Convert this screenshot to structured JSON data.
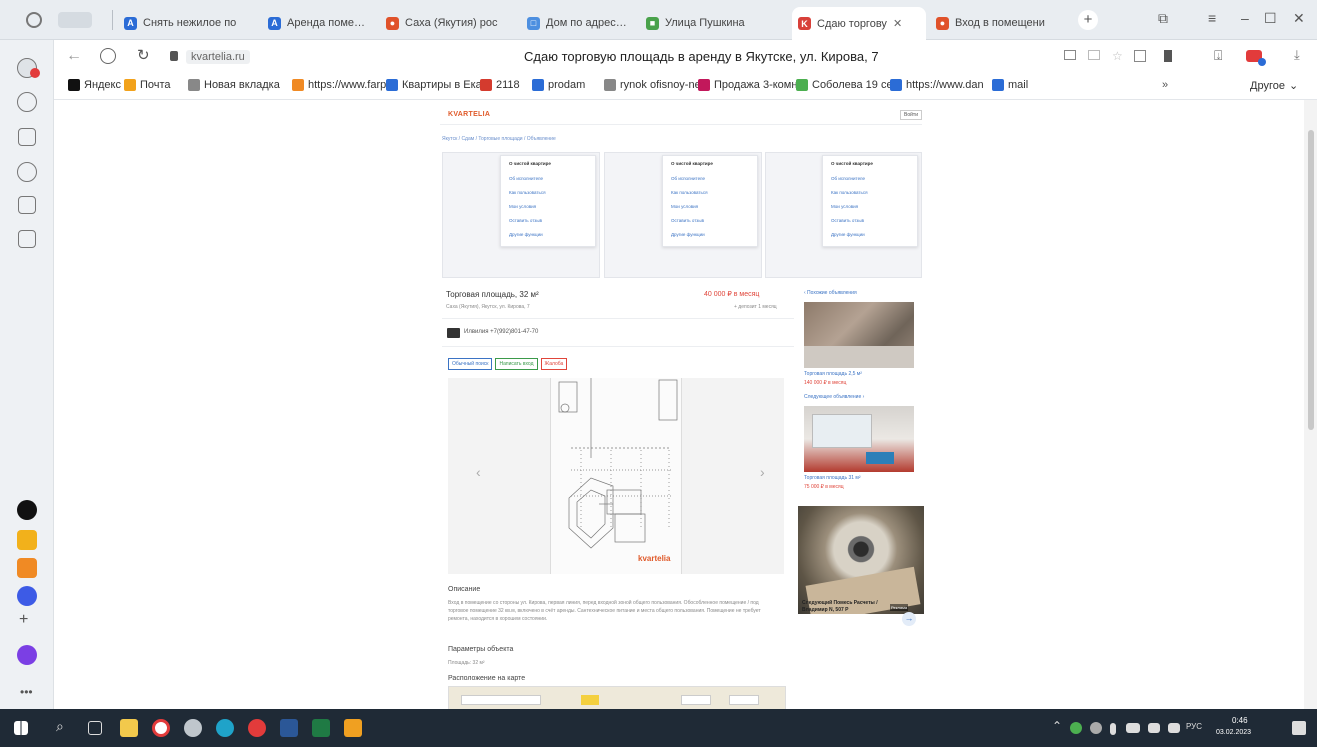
{
  "browser": {
    "tabs": [
      {
        "label": "Снять нежилое по",
        "color": "#2b6cd6",
        "glyph": "A"
      },
      {
        "label": "Аренда помещени",
        "color": "#2b6cd6",
        "glyph": "A"
      },
      {
        "label": "Сахa (Якутия) рос",
        "color": "#e0522a",
        "glyph": "●"
      },
      {
        "label": "Дом по адресу Як",
        "color": "#4d8fe0",
        "glyph": "□"
      },
      {
        "label": "Улица Пушкина",
        "color": "#49a24b",
        "glyph": "■"
      },
      {
        "label": "Сдаю торгову",
        "color": "#d8403a",
        "glyph": "K",
        "active": true
      },
      {
        "label": "Вход в помещени",
        "color": "#e0522a",
        "glyph": "●"
      }
    ],
    "new_tab_glyph": "+",
    "window_controls": {
      "minimize": "–",
      "maximize": "☐",
      "close": "✕"
    },
    "address": {
      "domain": "kvartelia.ru",
      "page_title": "Сдаю торговую площадь в аренду в Якутске, ул. Кирова, 7"
    },
    "bookmarks": [
      {
        "label": "Яндекс",
        "color": "#111111"
      },
      {
        "label": "Почта",
        "color": "#f2a21b"
      },
      {
        "label": "Новая вкладка",
        "color": "#888888"
      },
      {
        "label": "https://www.farp",
        "color": "#f08a24"
      },
      {
        "label": "Квартиры в Екат",
        "color": "#2b6cd6"
      },
      {
        "label": "2118",
        "color": "#d43b2e"
      },
      {
        "label": "prodam",
        "color": "#2b6cd6"
      },
      {
        "label": "rynok ofisnoy-ne",
        "color": "#888888"
      },
      {
        "label": "Продажа 3-комн",
        "color": "#c2185b"
      },
      {
        "label": "Соболева 19 сек",
        "color": "#4caf50"
      },
      {
        "label": "https://www.dan",
        "color": "#2b6cd6"
      },
      {
        "label": "mail",
        "color": "#2b6cd6"
      }
    ],
    "bookmarks_more": "Другое"
  },
  "site": {
    "logo": "KVARTELIA",
    "header_button": "Войти",
    "breadcrumb": "Якутск / Сдам / Торговые площади / Объявление",
    "dropdowns": [
      {
        "head": "О чистой квартире",
        "items": [
          "Об исполнителе",
          "Как пользоваться",
          "Мои условия",
          "Оставить отзыв",
          "Другие функции"
        ]
      },
      {
        "head": "О чистой квартире",
        "items": [
          "Об исполнителе",
          "Как пользоваться",
          "Мои условия",
          "Оставить отзыв",
          "Другие функции"
        ]
      },
      {
        "head": "О чистой квартире",
        "items": [
          "Об исполнителе",
          "Как пользоваться",
          "Мои условия",
          "Оставить отзыв",
          "Другие функции"
        ]
      }
    ],
    "listing": {
      "title": "Торговая площадь, 32 м²",
      "address": "Саха (Якутия), Якутск, ул. Кирова, 7",
      "price": "40 000 ₽ в месяц",
      "price_note": "+ депозит 1 месяц",
      "contact": "Илвилия +7(992)801-47-70",
      "chips": [
        "Обычный поиск",
        "Написать вход",
        "Жалоба"
      ],
      "prev_arrow": "‹",
      "next_arrow": "›",
      "watermark": "kvartelia",
      "description_title": "Описание",
      "description": "Вход в помещение со стороны ул. Кирова, первая линия, перед входной зоной общего пользования. Обособленное помещение / под торговое помещение 32 кв.м, включено в счёт аренды. Сантехническое питание и места общего пользования. Помещение не требует ремонта, находится в хорошем состоянии.",
      "params_title": "Параметры объекта",
      "params_value": "Площадь: 32 м²",
      "map_title": "Расположение на карте"
    },
    "side": {
      "link_top": "‹ Похожие объявления",
      "card1_title": "Торговая площадь 2,5 м²",
      "card1_price": "140 000 ₽ в месяц",
      "link_mid": "Следующее объявление ›",
      "card2_title": "Торговая площадь 31 м²",
      "card2_price": "75 000 ₽ в месяц",
      "ad_text": "Следующий Помесь Расчеты / Владимир N, 507 P",
      "ad_badge": "Реклама"
    }
  },
  "taskbar": {
    "lang": "РУС",
    "time": "0:46",
    "date": "03.02.2023"
  }
}
